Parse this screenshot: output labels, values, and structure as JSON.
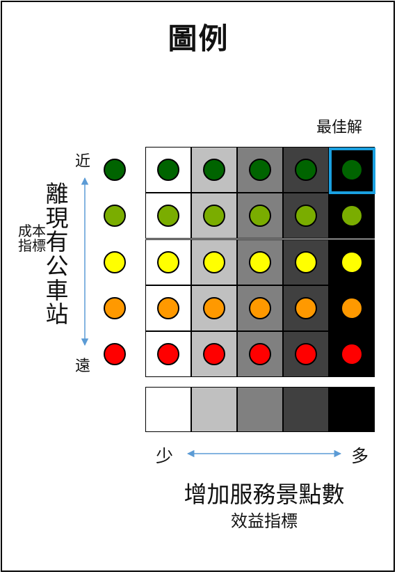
{
  "title": "圖例",
  "best_label": "最佳解",
  "y_axis": {
    "near_label": "近",
    "far_label": "遠",
    "title": "離現有公車站",
    "subtitle": "成本指標"
  },
  "x_axis": {
    "less_label": "少",
    "more_label": "多",
    "title": "增加服務景點數",
    "subtitle": "效益指標"
  },
  "row_colors": [
    "#006400",
    "#7aad00",
    "#ffff00",
    "#ff9900",
    "#ff0000"
  ],
  "column_shades": [
    "#ffffff",
    "#c0c0c0",
    "#808080",
    "#404040",
    "#000000"
  ],
  "highlight_color": "#1aa0e0",
  "arrow_color": "#5b9bd5"
}
